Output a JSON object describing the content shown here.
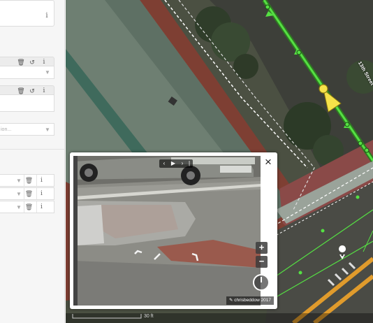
{
  "sidebar": {
    "info_label": "i",
    "delete_icon": "trash-icon",
    "undo_icon": "undo-icon",
    "partial_placeholder": "ion...",
    "field_rows": 3
  },
  "map": {
    "street_name": "13th Street",
    "scale_label": "30 ft",
    "colors": {
      "roof": "#6f7d6f",
      "brick": "#8a4433",
      "selected_way": "#55e043",
      "vertex": "#f6e24a",
      "road_orange": "#e09b2c"
    }
  },
  "viewer": {
    "close_label": "×",
    "nav_prev": "‹",
    "nav_play": "▶",
    "nav_next": "›",
    "nav_bar_label": "|",
    "zoom_in": "+",
    "zoom_out": "−",
    "attribution": "chrisbeddow 2017"
  }
}
